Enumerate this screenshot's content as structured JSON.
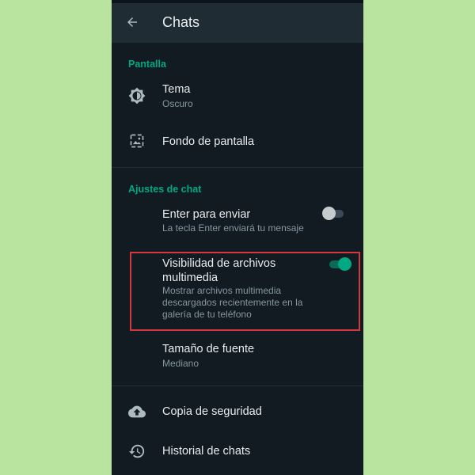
{
  "header": {
    "title": "Chats",
    "back_icon": "arrow-left-icon"
  },
  "sections": {
    "display": {
      "label": "Pantalla",
      "theme": {
        "title": "Tema",
        "value": "Oscuro",
        "icon": "theme-brightness-icon"
      },
      "wallpaper": {
        "title": "Fondo de pantalla",
        "icon": "wallpaper-icon"
      }
    },
    "chat_settings": {
      "label": "Ajustes de chat",
      "enter_to_send": {
        "title": "Enter para enviar",
        "subtitle": "La tecla Enter enviará tu mensaje",
        "enabled": false
      },
      "media_visibility": {
        "title_line1": "Visibilidad de archivos",
        "title_line2": "multimedia",
        "subtitle_line1": "Mostrar archivos multimedia",
        "subtitle_line2": "descargados recientemente en la",
        "subtitle_line3": "galería de tu teléfono",
        "enabled": true
      },
      "font_size": {
        "title": "Tamaño de fuente",
        "value": "Mediano"
      }
    },
    "other": {
      "backup": {
        "title": "Copia de seguridad",
        "icon": "cloud-upload-icon"
      },
      "history": {
        "title": "Historial de chats",
        "icon": "history-icon"
      }
    }
  },
  "colors": {
    "background": "#b8e4a0",
    "screen": "#121b22",
    "appbar": "#1f2c34",
    "accent": "#00a884",
    "highlight": "#d6363f"
  }
}
